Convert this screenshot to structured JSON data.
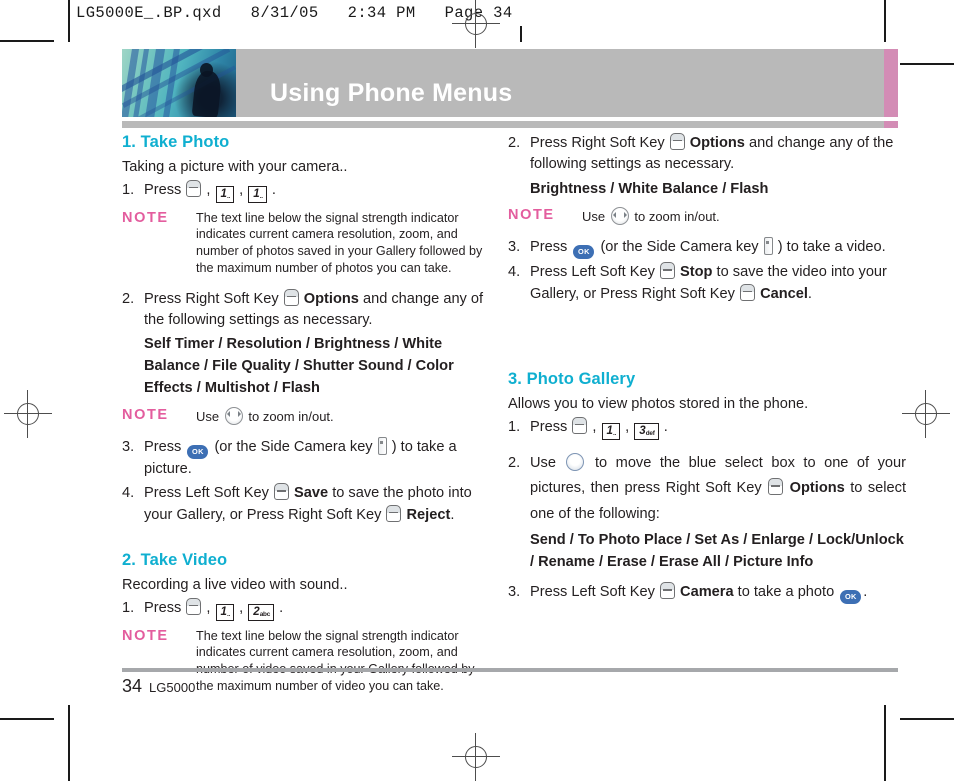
{
  "prepress": {
    "slug": "LG5000E_.BP.qxd   8/31/05   2:34 PM   Page 34"
  },
  "banner": {
    "title": "Using Phone Menus"
  },
  "footer": {
    "page_number": "34",
    "model": "LG5000"
  },
  "left_column": {
    "section1": {
      "heading": "1. Take Photo",
      "lead": "Taking a picture  with your camera..",
      "step1": {
        "num": "1.",
        "text_before": "Press",
        "text_after": "."
      },
      "note1": {
        "label": "NOTE",
        "body": "The text line below the signal strength indicator indicates current camera resolution, zoom, and number of photos saved in your Gallery followed by the maximum number of photos you can take."
      },
      "step2": {
        "num": "2.",
        "text_before": "Press Right Soft Key",
        "keyword": "Options",
        "text_after": "and change any of the following settings as necessary."
      },
      "options_list": "Self Timer / Resolution / Brightness / White Balance / File Quality / Shutter Sound / Color Effects / Multishot / Flash",
      "note2": {
        "label": "NOTE",
        "before": "Use",
        "after": "to zoom in/out."
      },
      "step3": {
        "num": "3.",
        "text_before": "Press",
        "text_mid": "(or the Side Camera key",
        "text_after": ") to take a picture."
      },
      "step4": {
        "num": "4.",
        "text_before": "Press Left Soft Key",
        "keyword1": "Save",
        "text_mid": "to save the photo into your Gallery, or Press Right Soft Key",
        "keyword2": "Reject",
        "text_after": "."
      }
    },
    "section2": {
      "heading": "2. Take Video",
      "lead": "Recording a live video with sound..",
      "step1": {
        "num": "1.",
        "text_before": "Press",
        "text_after": "."
      },
      "note1": {
        "label": "NOTE",
        "body": "The text line below the signal strength indicator indicates current camera resolution, zoom, and number of video saved in your Gallery followed by the maximum number of video you can take."
      }
    }
  },
  "right_column": {
    "section2_cont": {
      "step2": {
        "num": "2.",
        "text_before": "Press Right Soft Key",
        "keyword": "Options",
        "text_after": "and change any of the following settings as necessary."
      },
      "options_list": "Brightness / White Balance / Flash",
      "note": {
        "label": "NOTE",
        "before": "Use",
        "after": "to zoom in/out."
      },
      "step3": {
        "num": "3.",
        "text_before": "Press",
        "text_mid": "(or the Side Camera key",
        "text_after": ") to take a video."
      },
      "step4": {
        "num": "4.",
        "text_before": "Press Left Soft Key",
        "keyword1": "Stop",
        "text_mid": "to save the video into your Gallery, or Press Right Soft Key",
        "keyword2": "Cancel",
        "text_after": "."
      }
    },
    "section3": {
      "heading": "3. Photo Gallery",
      "lead": "Allows you to view photos stored in the phone.",
      "step1": {
        "num": "1.",
        "text_before": "Press",
        "text_after": "."
      },
      "step2": {
        "num": "2.",
        "text_before": "Use",
        "text_mid": "to move the blue select box to one of your pictures, then press Right Soft Key",
        "keyword": "Options",
        "text_after": "to select one of the following:"
      },
      "options_list": "Send / To Photo Place / Set As / Enlarge / Lock/Unlock / Rename / Erase / Erase All / Picture Info",
      "step3": {
        "num": "3.",
        "text_before": "Press Left Soft Key",
        "keyword": "Camera",
        "text_after": "to take a photo",
        "text_end": "."
      }
    }
  },
  "keys": {
    "softkey": "soft-key",
    "key1": {
      "digit": "1",
      "letters": "○○"
    },
    "key2": {
      "digit": "2",
      "letters": "abc"
    },
    "key3": {
      "digit": "3",
      "letters": "def"
    },
    "ok": "OK"
  },
  "colors": {
    "heading": "#0fafd0",
    "note": "#e35d9e",
    "banner_bar": "#b9b9b9",
    "banner_accent": "#d38cb5",
    "ok_key": "#3d6fb4"
  }
}
